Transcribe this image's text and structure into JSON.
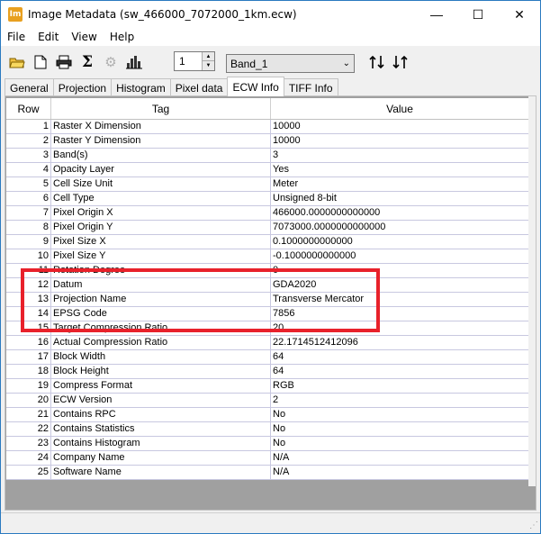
{
  "window": {
    "title": "Image Metadata (sw_466000_7072000_1km.ecw)",
    "app_icon_text": "Im",
    "minimize": "—",
    "maximize": "☐",
    "close": "✕"
  },
  "menu": [
    "File",
    "Edit",
    "View",
    "Help"
  ],
  "toolbar": {
    "band_number": "1",
    "band_select": "Band_1"
  },
  "tabs": [
    "General",
    "Projection",
    "Histogram",
    "Pixel data",
    "ECW Info",
    "TIFF Info"
  ],
  "active_tab": "ECW Info",
  "table": {
    "headers": [
      "Row",
      "Tag",
      "Value"
    ],
    "rows": [
      [
        "1",
        "Raster X Dimension",
        "10000"
      ],
      [
        "2",
        "Raster Y Dimension",
        "10000"
      ],
      [
        "3",
        "Band(s)",
        "3"
      ],
      [
        "4",
        "Opacity Layer",
        "Yes"
      ],
      [
        "5",
        "Cell Size Unit",
        "Meter"
      ],
      [
        "6",
        "Cell Type",
        "Unsigned 8-bit"
      ],
      [
        "7",
        "Pixel Origin X",
        "466000.0000000000000"
      ],
      [
        "8",
        "Pixel Origin Y",
        "7073000.0000000000000"
      ],
      [
        "9",
        "Pixel Size X",
        "0.1000000000000"
      ],
      [
        "10",
        "Pixel Size Y",
        "-0.1000000000000"
      ],
      [
        "11",
        "Rotation Degree",
        "0"
      ],
      [
        "12",
        "Datum",
        "GDA2020"
      ],
      [
        "13",
        "Projection Name",
        "Transverse Mercator"
      ],
      [
        "14",
        "EPSG Code",
        "7856"
      ],
      [
        "15",
        "Target Compression Ratio",
        "20"
      ],
      [
        "16",
        "Actual Compression Ratio",
        "22.1714512412096"
      ],
      [
        "17",
        "Block Width",
        "64"
      ],
      [
        "18",
        "Block Height",
        "64"
      ],
      [
        "19",
        "Compress Format",
        "RGB"
      ],
      [
        "20",
        "ECW Version",
        "2"
      ],
      [
        "21",
        "Contains RPC",
        "No"
      ],
      [
        "22",
        "Contains Statistics",
        "No"
      ],
      [
        "23",
        "Contains Histogram",
        "No"
      ],
      [
        "24",
        "Company Name",
        "N/A"
      ],
      [
        "25",
        "Software Name",
        "N/A"
      ]
    ]
  },
  "highlight_color": "#e8212b"
}
